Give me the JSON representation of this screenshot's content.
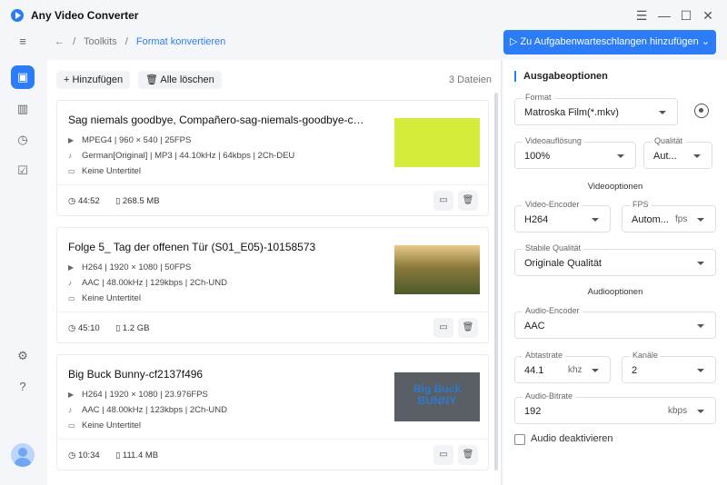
{
  "app": {
    "title": "Any Video Converter",
    "accent": "#2b7cf6"
  },
  "titlebar": {
    "menu_icon": "menu-icon",
    "min_icon": "minimize-icon",
    "max_icon": "maximize-icon",
    "close_icon": "close-icon"
  },
  "breadcrumb": {
    "root": "Toolkits",
    "sep": "/",
    "current": "Format konvertieren"
  },
  "queue_button": "Zu Aufgabenwarteschlangen hinzufügen",
  "toolbar": {
    "add": "Hinzufügen",
    "clear": "Alle löschen",
    "count": "3 Dateien"
  },
  "files": [
    {
      "title": "Sag niemals goodbye, Compañero-sag-niemals-goodbye-compaer...",
      "video": "MPEG4 | 960 × 540 | 25FPS",
      "audio": "German[Original] | MP3 | 44.10kHz | 64kbps | 2Ch-DEU",
      "subtitle": "Keine Untertitel",
      "duration": "44:52",
      "size": "268.5 MB",
      "thumb_color": "#d6ec3a"
    },
    {
      "title": "Folge 5_ Tag der offenen Tür (S01_E05)-10158573",
      "video": "H264 | 1920 × 1080 | 50FPS",
      "audio": "AAC | 48.00kHz | 129kbps | 2Ch-UND",
      "subtitle": "Keine Untertitel",
      "duration": "45:10",
      "size": "1.2 GB",
      "thumb_color": "#8a7a3c"
    },
    {
      "title": "Big Buck Bunny-cf2137f496",
      "video": "H264 | 1920 × 1080 | 23.976FPS",
      "audio": "AAC | 48.00kHz | 123kbps | 2Ch-UND",
      "subtitle": "Keine Untertitel",
      "duration": "10:34",
      "size": "111.4 MB",
      "thumb_color": "#5a5f66",
      "thumb_text": "Big Buck BUNNY"
    }
  ],
  "output": {
    "title": "Ausgabeoptionen",
    "format_label": "Format",
    "format_value": "Matroska Film(*.mkv)",
    "resolution_label": "Videoauflösung",
    "resolution_value": "100%",
    "quality_label": "Qualität",
    "quality_value": "Aut...",
    "video_section": "Videooptionen",
    "encoder_label": "Video-Encoder",
    "encoder_value": "H264",
    "fps_label": "FPS",
    "fps_value": "Autom...",
    "fps_unit": "fps",
    "stable_label": "Stabile Qualität",
    "stable_value": "Originale Qualität",
    "audio_section": "Audiooptionen",
    "aencoder_label": "Audio-Encoder",
    "aencoder_value": "AAC",
    "rate_label": "Abtastrate",
    "rate_value": "44.1",
    "rate_unit": "khz",
    "channels_label": "Kanäle",
    "channels_value": "2",
    "bitrate_label": "Audio-Bitrate",
    "bitrate_value": "192",
    "bitrate_unit": "kbps",
    "disable_audio": "Audio deaktivieren"
  }
}
